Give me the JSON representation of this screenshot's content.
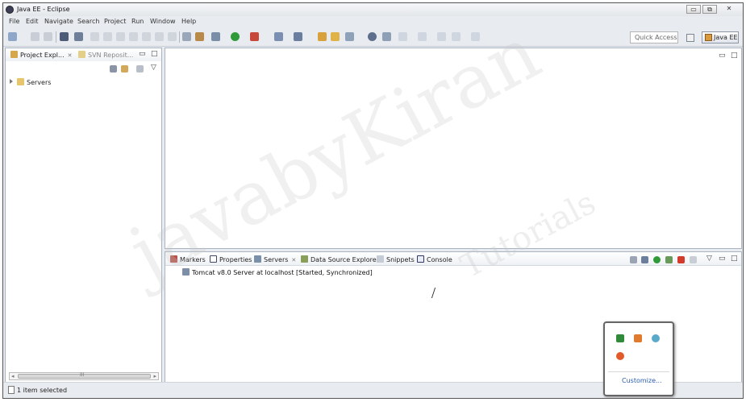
{
  "window": {
    "title": "Java EE - Eclipse",
    "controls": [
      "▭",
      "⧉",
      "✕"
    ]
  },
  "menu": [
    "File",
    "Edit",
    "Navigate",
    "Search",
    "Project",
    "Run",
    "Window",
    "Help"
  ],
  "toolbar": {
    "quick_access": "Quick Access",
    "perspective": "Java EE"
  },
  "left_pane": {
    "tabs": [
      "Project Expl...",
      "SVN Reposit..."
    ],
    "tree": [
      "Servers"
    ],
    "scroll_label": "III"
  },
  "bottom_pane": {
    "tabs": [
      "Markers",
      "Properties",
      "Servers",
      "Data Source Explorer",
      "Snippets",
      "Console"
    ],
    "server_row": "Tomcat v8.0 Server at localhost  [Started, Synchronized]"
  },
  "status": {
    "text": "1 item selected"
  },
  "popup": {
    "customize": "Customize..."
  },
  "watermark": {
    "main": "javabyKiran",
    "sub": "Tutorials"
  }
}
